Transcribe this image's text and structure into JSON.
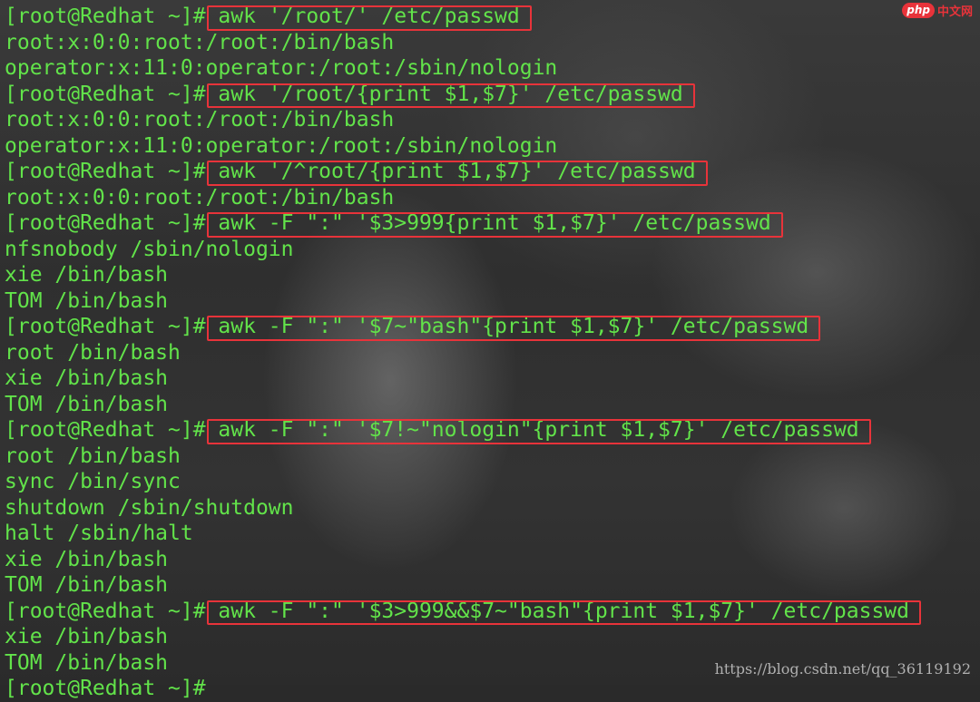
{
  "badge": {
    "logo": "php",
    "text": "中文网"
  },
  "watermark": "https://blog.csdn.net/qq_36119192",
  "terminal": {
    "lines": [
      {
        "type": "cmd",
        "prompt": "[root@Redhat ~]#",
        "command": " awk '/root/' /etc/passwd",
        "boxed": true
      },
      {
        "type": "out",
        "text": "root:x:0:0:root:/root:/bin/bash"
      },
      {
        "type": "out",
        "text": "operator:x:11:0:operator:/root:/sbin/nologin"
      },
      {
        "type": "cmd",
        "prompt": "[root@Redhat ~]#",
        "command": " awk '/root/{print $1,$7}' /etc/passwd",
        "boxed": true
      },
      {
        "type": "out",
        "text": "root:x:0:0:root:/root:/bin/bash"
      },
      {
        "type": "out",
        "text": "operator:x:11:0:operator:/root:/sbin/nologin"
      },
      {
        "type": "cmd",
        "prompt": "[root@Redhat ~]#",
        "command": " awk '/^root/{print $1,$7}' /etc/passwd",
        "boxed": true
      },
      {
        "type": "out",
        "text": "root:x:0:0:root:/root:/bin/bash"
      },
      {
        "type": "cmd",
        "prompt": "[root@Redhat ~]#",
        "command": " awk -F \":\" '$3>999{print $1,$7}' /etc/passwd",
        "boxed": true
      },
      {
        "type": "out",
        "text": "nfsnobody /sbin/nologin"
      },
      {
        "type": "out",
        "text": "xie /bin/bash"
      },
      {
        "type": "out",
        "text": "TOM /bin/bash"
      },
      {
        "type": "cmd",
        "prompt": "[root@Redhat ~]#",
        "command": " awk -F \":\" '$7~\"bash\"{print $1,$7}' /etc/passwd",
        "boxed": true
      },
      {
        "type": "out",
        "text": "root /bin/bash"
      },
      {
        "type": "out",
        "text": "xie /bin/bash"
      },
      {
        "type": "out",
        "text": "TOM /bin/bash"
      },
      {
        "type": "cmd",
        "prompt": "[root@Redhat ~]#",
        "command": " awk -F \":\" '$7!~\"nologin\"{print $1,$7}' /etc/passwd",
        "boxed": true
      },
      {
        "type": "out",
        "text": "root /bin/bash"
      },
      {
        "type": "out",
        "text": "sync /bin/sync"
      },
      {
        "type": "out",
        "text": "shutdown /sbin/shutdown"
      },
      {
        "type": "out",
        "text": "halt /sbin/halt"
      },
      {
        "type": "out",
        "text": "xie /bin/bash"
      },
      {
        "type": "out",
        "text": "TOM /bin/bash"
      },
      {
        "type": "cmd",
        "prompt": "[root@Redhat ~]#",
        "command": " awk -F \":\" '$3>999&&$7~\"bash\"{print $1,$7}' /etc/passwd",
        "boxed": true
      },
      {
        "type": "out",
        "text": "xie /bin/bash"
      },
      {
        "type": "out",
        "text": "TOM /bin/bash"
      },
      {
        "type": "cmd",
        "prompt": "[root@Redhat ~]#",
        "command": "",
        "boxed": false
      }
    ]
  },
  "colors": {
    "text": "#62e34a",
    "highlight": "#e8333a"
  }
}
